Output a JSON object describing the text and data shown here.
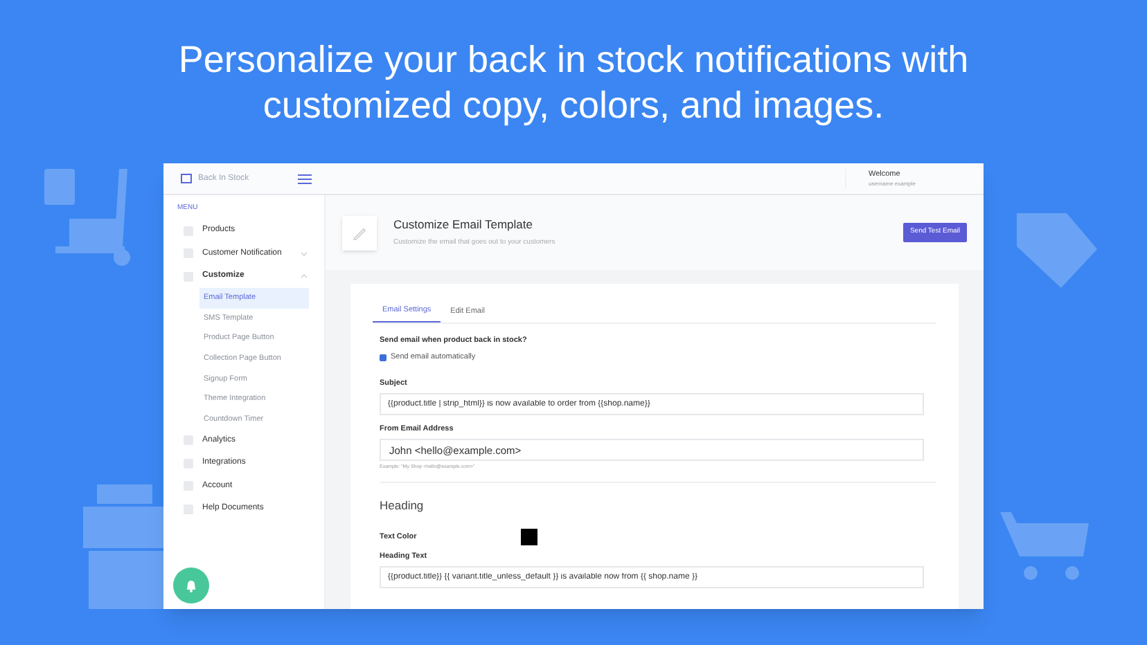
{
  "headline": "Personalize your back in stock notifications with customized copy, colors, and images.",
  "app": {
    "logo_text": "Back In Stock",
    "user": {
      "greeting": "Welcome",
      "name": "username example"
    }
  },
  "sidebar": {
    "menu_label": "MENU",
    "items": [
      {
        "label": "Products",
        "selected": false
      },
      {
        "label": "Customer Notification",
        "selected": false,
        "expanded": false
      },
      {
        "label": "Customize",
        "selected": false,
        "expanded": true,
        "children": [
          {
            "label": "Email Template",
            "selected": true
          },
          {
            "label": "SMS Template",
            "selected": false
          },
          {
            "label": "Product Page Button",
            "selected": false
          },
          {
            "label": "Collection Page Button",
            "selected": false
          },
          {
            "label": "Signup Form",
            "selected": false
          },
          {
            "label": "Theme Integration",
            "selected": false
          },
          {
            "label": "Countdown Timer",
            "selected": false
          }
        ]
      },
      {
        "label": "Analytics",
        "selected": false
      },
      {
        "label": "Integrations",
        "selected": false
      },
      {
        "label": "Account",
        "selected": false
      },
      {
        "label": "Help Documents",
        "selected": false
      }
    ]
  },
  "page_header": {
    "title": "Customize Email Template",
    "subtitle": "Customize the email that goes out to your customers",
    "button": "Send Test Email"
  },
  "tabs": [
    {
      "label": "Email Settings",
      "selected": true
    },
    {
      "label": "Edit Email",
      "selected": false
    }
  ],
  "form": {
    "send_question": "Send email when product back in stock?",
    "send_checkbox": {
      "label": "Send email automatically",
      "checked": true
    },
    "subject": {
      "label": "Subject",
      "value": "{{product.title | strip_html}} is now available to order from {{shop.name}}"
    },
    "from": {
      "label": "From Email Address",
      "value": "John <hello@example.com>",
      "hint": "Example: \"My Shop <hello@example.com>\""
    }
  },
  "heading_section": {
    "title": "Heading",
    "text_color": {
      "label": "Text Color",
      "color": "#000000"
    },
    "heading_text": {
      "label": "Heading Text",
      "value": "{{product.title}} {{ variant.title_unless_default }} is available now from {{ shop.name }}"
    }
  }
}
